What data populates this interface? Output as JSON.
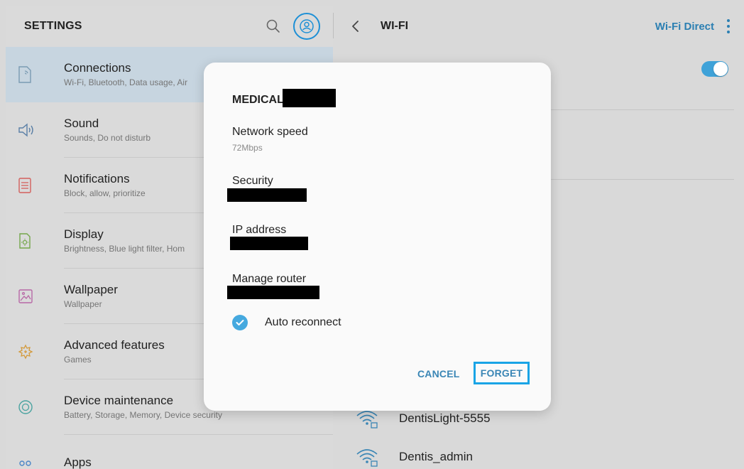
{
  "settings": {
    "title": "SETTINGS",
    "items": [
      {
        "title": "Connections",
        "subtitle": "Wi-Fi, Bluetooth, Data usage, Air",
        "icon": "connections-icon",
        "selected": true
      },
      {
        "title": "Sound",
        "subtitle": "Sounds, Do not disturb",
        "icon": "sound-icon"
      },
      {
        "title": "Notifications",
        "subtitle": "Block, allow, prioritize",
        "icon": "notifications-icon"
      },
      {
        "title": "Display",
        "subtitle": "Brightness, Blue light filter, Hom",
        "icon": "display-icon"
      },
      {
        "title": "Wallpaper",
        "subtitle": "Wallpaper",
        "icon": "wallpaper-icon"
      },
      {
        "title": "Advanced features",
        "subtitle": "Games",
        "icon": "advanced-features-icon"
      },
      {
        "title": "Device maintenance",
        "subtitle": "Battery, Storage, Memory, Device security",
        "icon": "device-maintenance-icon"
      },
      {
        "title": "Apps",
        "subtitle": "",
        "icon": "apps-icon"
      }
    ]
  },
  "wifi": {
    "title": "WI-FI",
    "wifi_direct": "Wi-Fi Direct",
    "toggle_on": true,
    "networks": [
      {
        "name": "DentisLight-5555"
      },
      {
        "name": "Dentis_admin"
      }
    ]
  },
  "dialog": {
    "network_name": "MEDICAL",
    "speed_label": "Network speed",
    "speed_value": "72Mbps",
    "security_label": "Security",
    "ip_label": "IP address",
    "router_label": "Manage router",
    "auto_reconnect_label": "Auto reconnect",
    "auto_reconnect_checked": true,
    "cancel_label": "CANCEL",
    "forget_label": "FORGET"
  },
  "colors": {
    "accent": "#2b7fb2",
    "highlight_border": "#19a4e6",
    "selected_row": "#c7d5e0"
  }
}
